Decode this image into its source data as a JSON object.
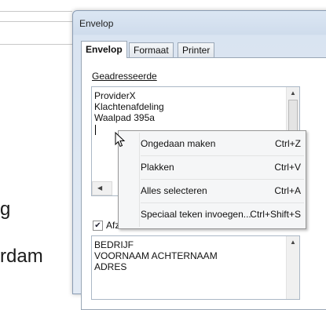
{
  "document": {
    "text_fragments": [
      "g",
      "rdam"
    ]
  },
  "dialog": {
    "title": "Envelop",
    "tabs": [
      {
        "label": "Envelop",
        "active": true
      },
      {
        "label": "Formaat",
        "active": false
      },
      {
        "label": "Printer",
        "active": false
      }
    ],
    "recipient": {
      "label": "Geadresseerde",
      "lines": [
        "ProviderX",
        "Klachtenafdeling",
        "Waalpad 395a"
      ]
    },
    "sender": {
      "checkbox_label": "Afzender",
      "checked": true,
      "lines": [
        "BEDRIJF",
        "VOORNAAM ACHTERNAAM",
        "ADRES"
      ]
    }
  },
  "context_menu": {
    "items": [
      {
        "label": "Ongedaan maken",
        "shortcut": "Ctrl+Z"
      },
      {
        "label": "Plakken",
        "shortcut": "Ctrl+V"
      },
      {
        "label": "Alles selecteren",
        "shortcut": "Ctrl+A"
      },
      {
        "label": "Speciaal teken invoegen...",
        "shortcut": "Ctrl+Shift+S"
      }
    ]
  },
  "colors": {
    "dialog_bg": "#dbe6f3",
    "panel_bg": "#ffffff",
    "menu_bg": "#f5f6f7"
  },
  "icons": [
    "checkmark-icon",
    "scroll-up-arrow-icon",
    "scroll-down-arrow-icon",
    "scroll-left-arrow-icon",
    "mouse-pointer-icon"
  ]
}
